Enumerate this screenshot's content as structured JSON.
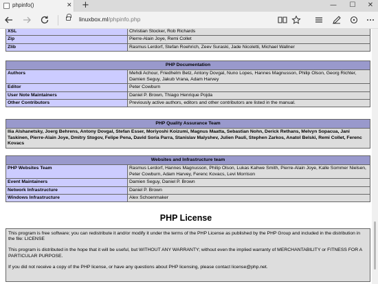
{
  "browser": {
    "tab_title": "phpinfo()",
    "tab_close": "✕",
    "new_tab": "+",
    "minimize": "—",
    "maximize": "☐",
    "close": "✕",
    "url_domain": "linuxbox.ml",
    "url_path": "/phpinfo.php",
    "icons": [
      "back-arrow-icon",
      "forward-arrow-icon",
      "refresh-icon",
      "lock-icon",
      "reading-view-icon",
      "favorite-star-icon",
      "hub-icon",
      "web-note-icon",
      "share-icon",
      "more-icon"
    ]
  },
  "top_rows": [
    {
      "label": "XSL",
      "value": "Christian Stocker, Rob Richards"
    },
    {
      "label": "Zip",
      "value": "Pierre-Alain Joye, Remi Collet"
    },
    {
      "label": "Zlib",
      "value": "Rasmus Lerdorf, Stefan Roehrich, Zeev Suraski, Jade Nicoletti, Michael Wallner"
    }
  ],
  "documentation": {
    "header": "PHP Documentation",
    "rows": [
      {
        "label": "Authors",
        "value": "Mehdi Achour, Friedhelm Betz, Antony Dovgal, Nuno Lopes, Hannes Magnusson, Philip Olson, Georg Richter, Damien Seguy, Jakub Vrana, Adam Harvey"
      },
      {
        "label": "Editor",
        "value": "Peter Cowburn"
      },
      {
        "label": "User Note Maintainers",
        "value": "Daniel P. Brown, Thiago Henrique Pojda"
      },
      {
        "label": "Other Contributors",
        "value": "Previously active authors, editors and other contributors are listed in the manual."
      }
    ]
  },
  "qa": {
    "header": "PHP Quality Assurance Team",
    "text": "Ilia Alshanetsky, Joerg Behrens, Antony Dovgal, Stefan Esser, Moriyoshi Koizumi, Magnus Maatta, Sebastian Nohn, Derick Rethans, Melvyn Sopacua, Jani Taskinen, Pierre-Alain Joye, Dmitry Stogov, Felipe Pena, David Soria Parra, Stanislav Malyshev, Julien Pauli, Stephen Zarkos, Anatol Belski, Remi Collet, Ferenc Kovacs"
  },
  "infra": {
    "header": "Websites and Infrastructure team",
    "rows": [
      {
        "label": "PHP Websites Team",
        "value": "Rasmus Lerdorf, Hannes Magnusson, Philip Olson, Lukas Kahwe Smith, Pierre-Alain Joye, Kalle Sommer Nielsen, Peter Cowburn, Adam Harvey, Ferenc Kovacs, Levi Morrison"
      },
      {
        "label": "Event Maintainers",
        "value": "Damien Seguy, Daniel P. Brown"
      },
      {
        "label": "Network Infrastructure",
        "value": "Daniel P. Brown"
      },
      {
        "label": "Windows Infrastructure",
        "value": "Alex Schoenmaker"
      }
    ]
  },
  "license": {
    "title": "PHP License",
    "p1": "This program is free software; you can redistribute it and/or modify it under the terms of the PHP License as published by the PHP Group and included in the distribution in the file: LICENSE",
    "p2": "This program is distributed in the hope that it will be useful, but WITHOUT ANY WARRANTY; without even the implied warranty of MERCHANTABILITY or FITNESS FOR A PARTICULAR PURPOSE.",
    "p3": "If you did not receive a copy of the PHP license, or have any questions about PHP licensing, please contact license@php.net."
  }
}
